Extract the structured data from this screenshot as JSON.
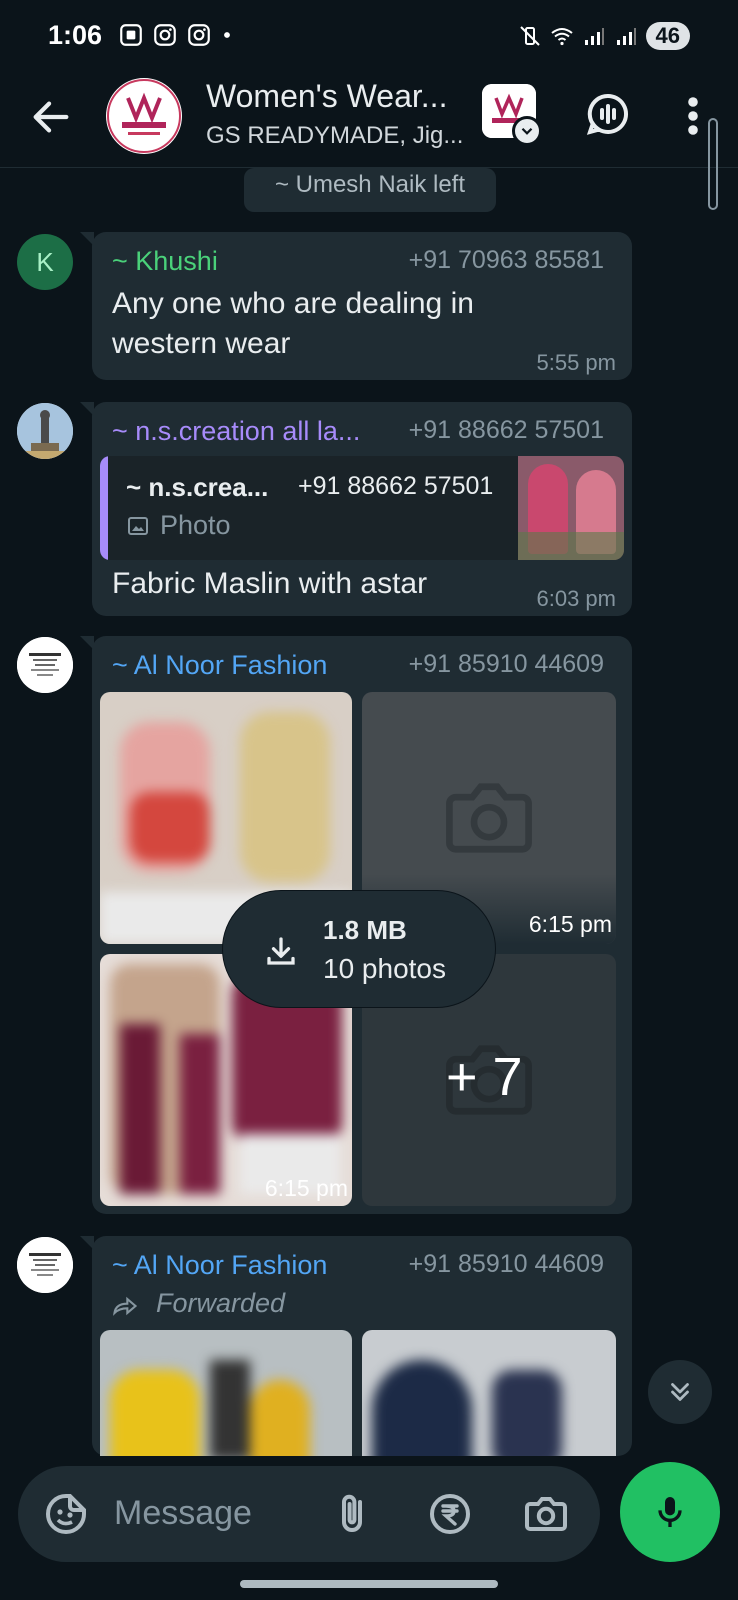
{
  "status": {
    "time": "1:06",
    "battery": "46"
  },
  "header": {
    "title": "Women's Wear...",
    "subtitle": "GS READYMADE, Jig..."
  },
  "system_message": "~ Umesh Naik left",
  "messages": [
    {
      "avatar_letter": "K",
      "sender": "~ Khushi",
      "sender_color": "#4ad17a",
      "phone": "+91 70963 85581",
      "text": "Any one who are dealing in western wear",
      "time": "5:55 pm"
    },
    {
      "sender": "~ n.s.creation all la...",
      "sender_color": "#a78bfa",
      "phone": "+91 88662 57501",
      "quote": {
        "sender": "~ n.s.crea...",
        "phone": "+91 88662 57501",
        "label": "Photo"
      },
      "text": "Fabric Maslin with astar",
      "time": "6:03 pm"
    },
    {
      "sender": "~ Al Noor Fashion",
      "sender_color": "#53a6f5",
      "phone": "+91 85910 44609",
      "time_a": "6:15 pm",
      "time_b": "6:15 pm",
      "more_count": "+ 7",
      "download": {
        "size": "1.8 MB",
        "count": "10 photos"
      }
    },
    {
      "sender": "~ Al Noor Fashion",
      "sender_color": "#53a6f5",
      "phone": "+91 85910 44609",
      "forwarded": "Forwarded"
    }
  ],
  "composer": {
    "placeholder": "Message"
  },
  "icons": {
    "back": "arrow-left-icon",
    "voice_chat": "voice-chat-icon",
    "menu": "more-vert-icon",
    "sticker": "sticker-icon",
    "attach": "paperclip-icon",
    "payment": "rupee-icon",
    "camera": "camera-icon",
    "mic": "mic-icon",
    "scroll_down": "double-chevron-down-icon"
  }
}
